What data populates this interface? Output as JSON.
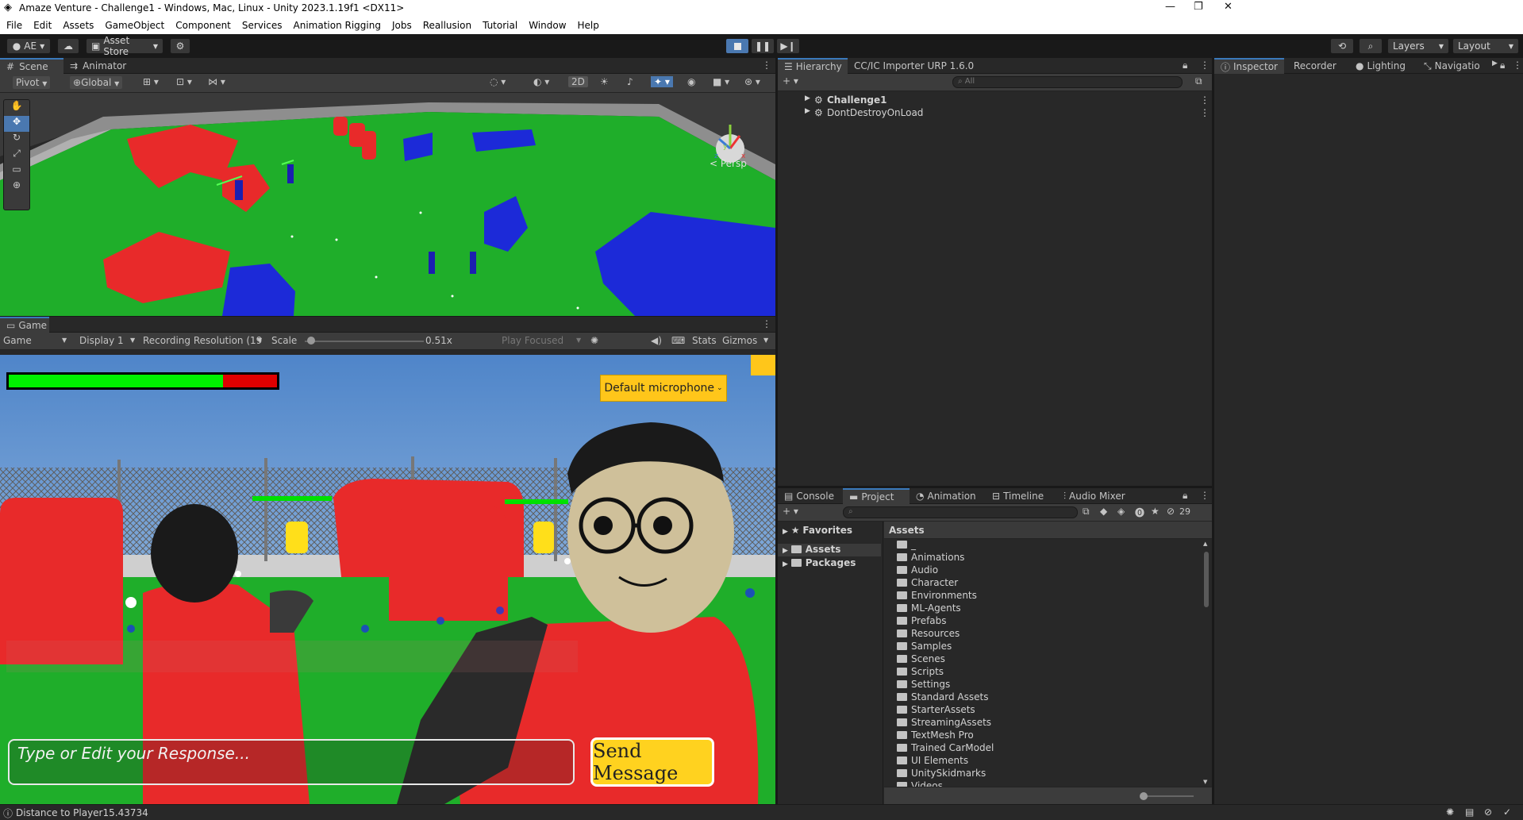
{
  "window": {
    "title": "Amaze Venture - Challenge1 - Windows, Mac, Linux - Unity 2023.1.19f1 <DX11>"
  },
  "menu": [
    "File",
    "Edit",
    "Assets",
    "GameObject",
    "Component",
    "Services",
    "Animation Rigging",
    "Jobs",
    "Reallusion",
    "Tutorial",
    "Window",
    "Help"
  ],
  "toolbar": {
    "account": "AE",
    "asset_store": "Asset Store",
    "layers": "Layers",
    "layout": "Layout"
  },
  "scene_panel": {
    "tabs": [
      "Scene",
      "Animator"
    ],
    "pivot": "Pivot",
    "global": "Global",
    "mode_2d": "2D",
    "persp": "< Persp",
    "gizmo_axes": {
      "y": "y",
      "x": "x",
      "z": "z"
    }
  },
  "game_panel": {
    "tab": "Game",
    "view_dropdown": "Game",
    "display": "Display 1",
    "resolution": "Recording Resolution (19",
    "scale_label": "Scale",
    "scale_value": "0.51x",
    "scale_fraction": 0.02,
    "play_focused": "Play Focused",
    "stats": "Stats",
    "gizmos": "Gizmos",
    "health_fraction": 0.8,
    "mic_button": "Default microphone",
    "input_placeholder": "Type or Edit your Response...",
    "send_button": "Send Message",
    "colors": {
      "health_green": "#00f000",
      "health_red": "#e00000",
      "mic_bg": "#ffc61a",
      "send_bg": "#ffd21f"
    }
  },
  "hierarchy": {
    "tabs": [
      "Hierarchy",
      "CC/IC Importer URP 1.6.0"
    ],
    "search_placeholder": "All",
    "items": [
      "Challenge1",
      "DontDestroyOnLoad"
    ]
  },
  "inspector_tabs": [
    "Inspector",
    "Recorder",
    "Lighting",
    "Navigatio"
  ],
  "bottom_panel": {
    "tabs": [
      "Console",
      "Project",
      "Animation",
      "Timeline",
      "Audio Mixer"
    ],
    "hidden_count": "29",
    "tree": [
      "Favorites",
      "Assets",
      "Packages"
    ],
    "path": "Assets",
    "folders": [
      "_",
      "Animations",
      "Audio",
      "Character",
      "Environments",
      "ML-Agents",
      "Prefabs",
      "Resources",
      "Samples",
      "Scenes",
      "Scripts",
      "Settings",
      "Standard Assets",
      "StarterAssets",
      "StreamingAssets",
      "TextMesh Pro",
      "Trained CarModel",
      "UI Elements",
      "UnitySkidmarks",
      "Videos"
    ]
  },
  "status": {
    "message": "Distance to Player15.43734"
  }
}
